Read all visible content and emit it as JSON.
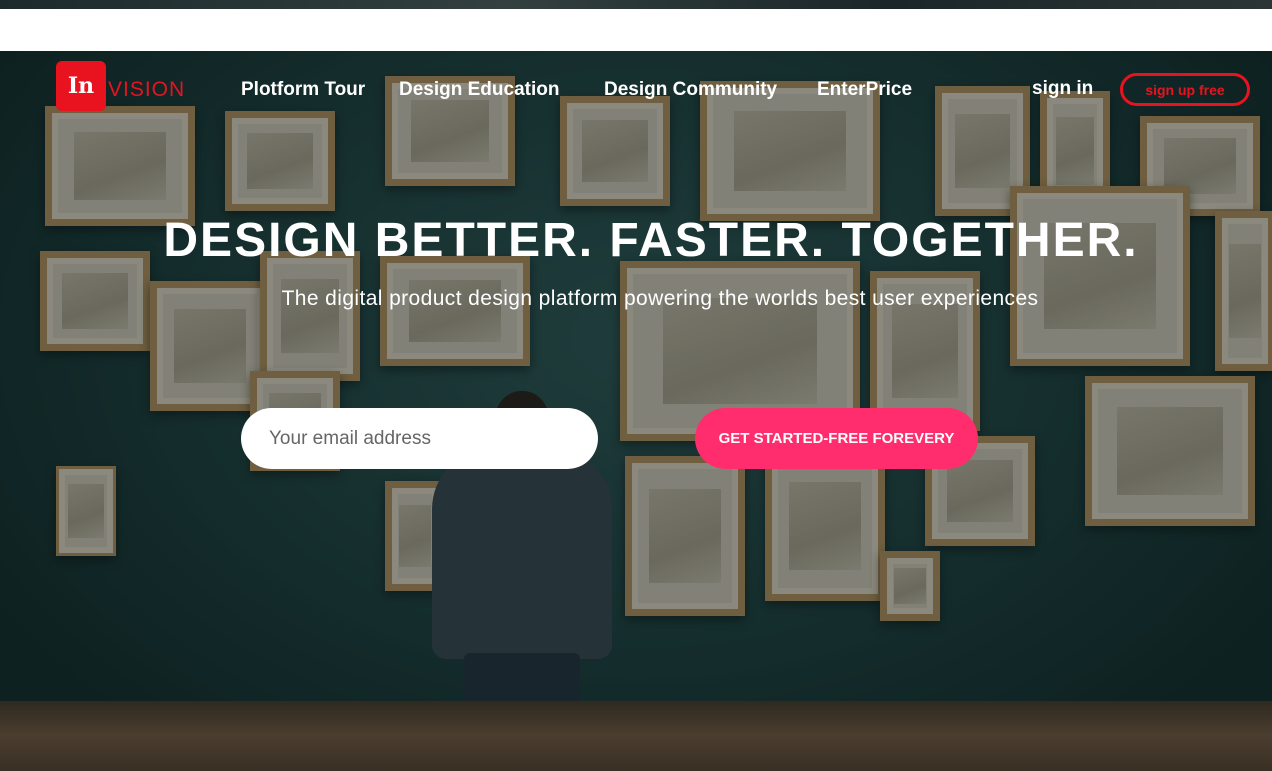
{
  "brand": {
    "logo_mark": "In",
    "name": "VISION",
    "color": "#e8131f"
  },
  "nav": {
    "items": [
      {
        "label": "Plotform Tour"
      },
      {
        "label": "Design Education"
      },
      {
        "label": "Design Community"
      },
      {
        "label": "EnterPrice"
      }
    ],
    "signin_label": "sign in",
    "signup_label": "sign up free"
  },
  "hero": {
    "headline": "DESIGN BETTER. FASTER. TOGETHER.",
    "subheadline": "The digital product design platform powering the worlds best user experiences",
    "email_placeholder": "Your email address",
    "cta_label": "GET STARTED-FREE FOREVERY",
    "cta_color": "#ff2d6d",
    "background_image": "gallery-visitor-photo"
  }
}
